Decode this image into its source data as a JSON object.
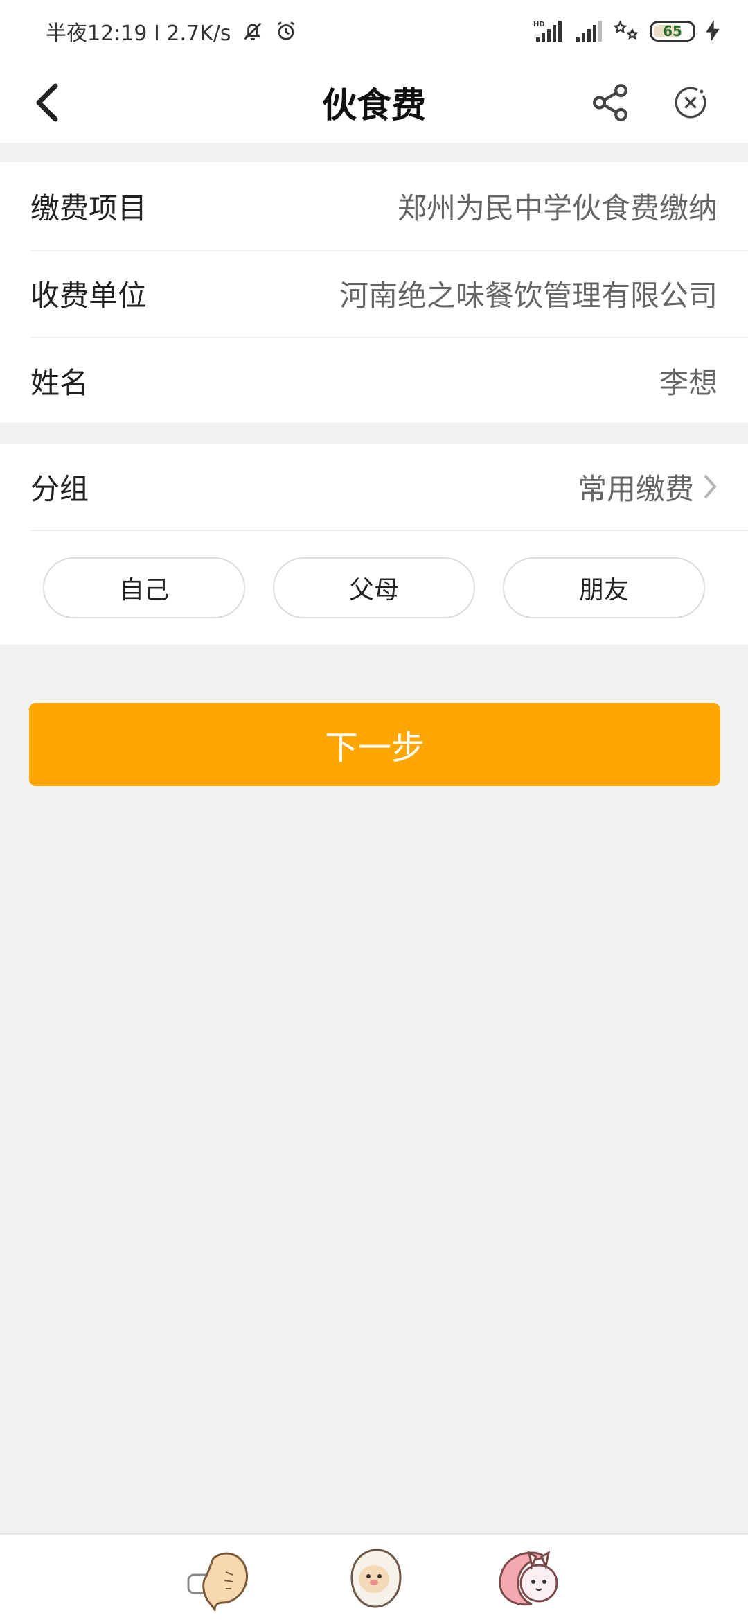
{
  "status_bar": {
    "time_speed": "半夜12:19 I 2.7K/s",
    "battery": "65",
    "icons": [
      "bell-off-icon",
      "alarm-icon",
      "hd-signal-icon",
      "signal-icon",
      "wifi-icon",
      "battery-icon",
      "charging-icon"
    ]
  },
  "nav": {
    "title": "伙食费",
    "icons": [
      "back-icon",
      "share-icon",
      "close-circle-icon"
    ]
  },
  "info": {
    "rows": [
      {
        "label": "缴费项目",
        "value": "郑州为民中学伙食费缴纳"
      },
      {
        "label": "收费单位",
        "value": "河南绝之味餐饮管理有限公司"
      },
      {
        "label": "姓名",
        "value": "李想"
      }
    ]
  },
  "group": {
    "label": "分组",
    "value": "常用缴费",
    "chips": [
      "自己",
      "父母",
      "朋友"
    ]
  },
  "next_button": "下一步",
  "colors": {
    "accent": "#fea702",
    "background": "#f2f2f2"
  },
  "bottom_bar": {
    "icons": [
      "fish-sticker-icon",
      "dumpling-sticker-icon",
      "bunny-sticker-icon"
    ]
  }
}
